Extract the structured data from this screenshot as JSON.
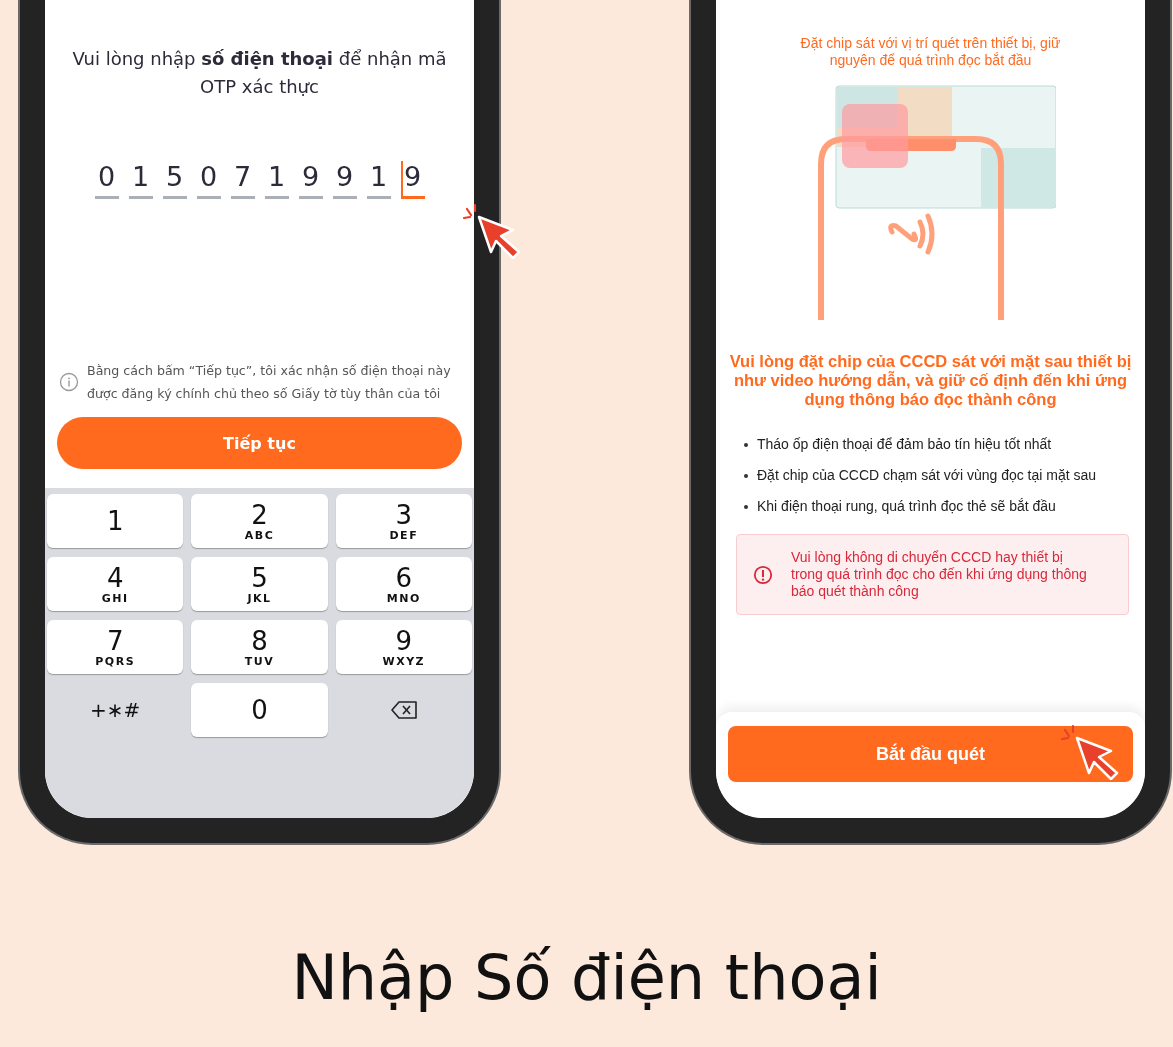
{
  "otp_screen": {
    "prompt": "Vui lòng nhập **số điện thoại** để nhận mã OTP xác thực",
    "digits": [
      {
        "value": "0",
        "focused": false
      },
      {
        "value": "1",
        "focused": false
      },
      {
        "value": "5",
        "focused": false
      },
      {
        "value": "0",
        "focused": false
      },
      {
        "value": "7",
        "focused": false
      },
      {
        "value": "1",
        "focused": false
      },
      {
        "value": "9",
        "focused": false
      },
      {
        "value": "9",
        "focused": false
      },
      {
        "value": "1",
        "focused": false
      },
      {
        "value": "9",
        "focused": true
      }
    ],
    "note": "Bằng cách bấm “Tiếp tục”, tôi xác nhận số điện thoại này được đăng ký chính chủ theo số Giấy tờ tùy thân của tôi",
    "button": "Tiếp tục",
    "keypad": [
      {
        "kind": "digit",
        "digit": "1"
      },
      {
        "kind": "digit",
        "digit": "2",
        "letters": "ABC"
      },
      {
        "kind": "digit",
        "digit": "3",
        "letters": "DEF"
      },
      {
        "kind": "digit",
        "digit": "4",
        "letters": "GHI"
      },
      {
        "kind": "digit",
        "digit": "5",
        "letters": "JKL"
      },
      {
        "kind": "digit",
        "digit": "6",
        "letters": "MNO"
      },
      {
        "kind": "digit",
        "digit": "7",
        "letters": "PQRS"
      },
      {
        "kind": "digit",
        "digit": "8",
        "letters": "TUV"
      },
      {
        "kind": "digit",
        "digit": "9",
        "letters": "WXYZ"
      },
      {
        "kind": "symbols",
        "digit": "+∗#"
      },
      {
        "kind": "digit",
        "digit": "0"
      },
      {
        "kind": "backspace"
      }
    ]
  },
  "scan_screen": {
    "hint": "Đặt chip sát với vị trí quét trên thiết bị, giữ nguyên để quá trình đọc bắt đầu",
    "instruction": "Vui lòng đặt chip của CCCD sát với mặt sau thiết bị như video hướng dẫn, và giữ cố định đến khi ứng dụng thông báo đọc thành công",
    "tips": [
      "Tháo ốp điện thoại để đảm bảo tín hiệu tốt nhất",
      "Đặt chip của CCCD chạm sát với vùng đọc tại mặt sau",
      "Khi điện thoại rung, quá trình đọc thẻ sẽ bắt đầu"
    ],
    "warning": "Vui lòng không di chuyển CCCD hay thiết bị trong quá trình đọc cho đến khi ứng dụng thông báo quét thành công",
    "button": "Bắt đầu quét"
  },
  "caption": "Nhập Số điện thoại"
}
